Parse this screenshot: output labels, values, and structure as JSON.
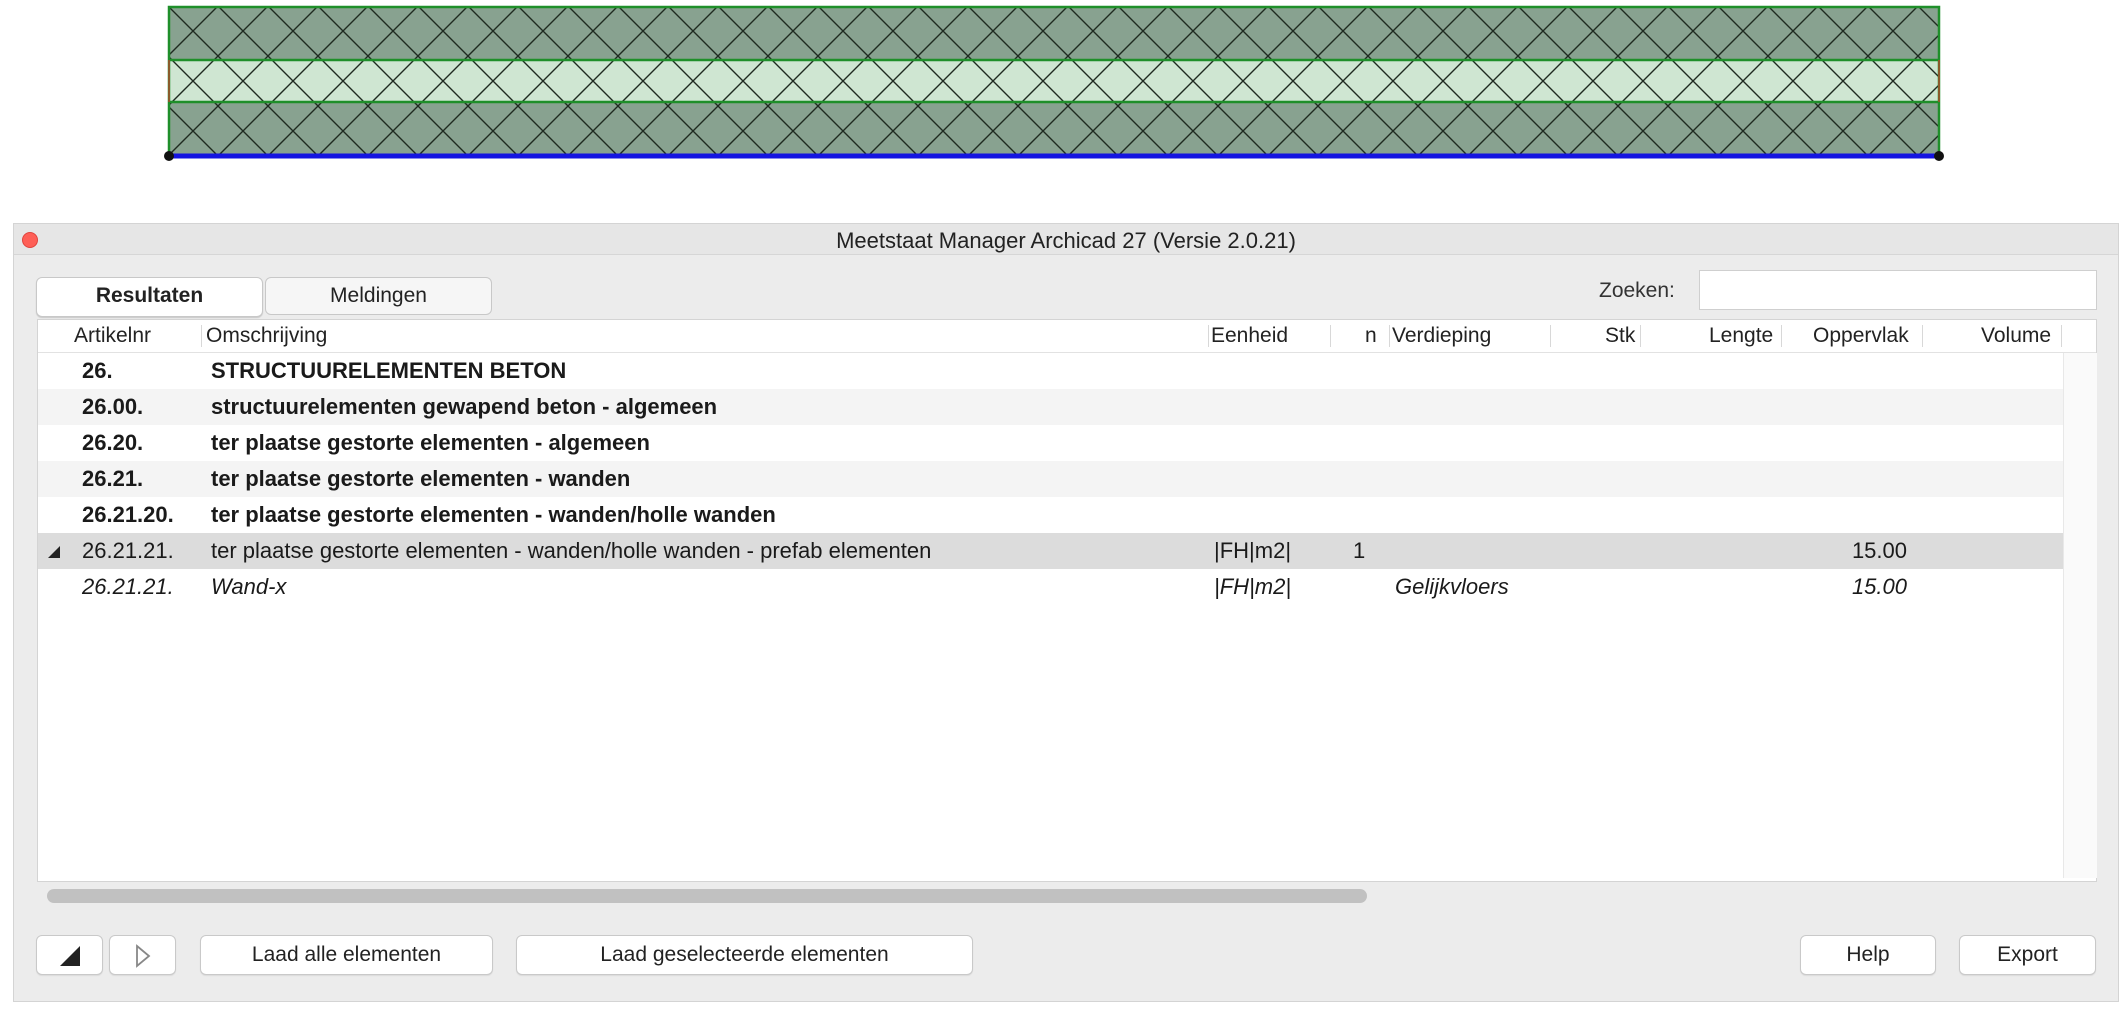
{
  "window": {
    "title": "Meetstaat Manager Archicad 27 (Versie 2.0.21)"
  },
  "tabs": [
    {
      "label": "Resultaten",
      "active": true
    },
    {
      "label": "Meldingen",
      "active": false
    }
  ],
  "search": {
    "label": "Zoeken:",
    "value": "",
    "placeholder": ""
  },
  "table": {
    "columns": [
      "Artikelnr",
      "Omschrijving",
      "Eenheid",
      "n",
      "Verdieping",
      "Stk",
      "Lengte",
      "Oppervlak",
      "Volume"
    ],
    "rows": [
      {
        "artikelnr": "26.",
        "omschrijving": "STRUCTUURELEMENTEN BETON",
        "eenheid": "",
        "n": "",
        "verdieping": "",
        "stk": "",
        "lengte": "",
        "oppervlak": "",
        "volume": "",
        "style": "bold"
      },
      {
        "artikelnr": "26.00.",
        "omschrijving": "structuurelementen gewapend beton - algemeen",
        "eenheid": "",
        "n": "",
        "verdieping": "",
        "stk": "",
        "lengte": "",
        "oppervlak": "",
        "volume": "",
        "style": "bold"
      },
      {
        "artikelnr": "26.20.",
        "omschrijving": "ter plaatse gestorte elementen - algemeen",
        "eenheid": "",
        "n": "",
        "verdieping": "",
        "stk": "",
        "lengte": "",
        "oppervlak": "",
        "volume": "",
        "style": "bold"
      },
      {
        "artikelnr": "26.21.",
        "omschrijving": "ter plaatse gestorte elementen - wanden",
        "eenheid": "",
        "n": "",
        "verdieping": "",
        "stk": "",
        "lengte": "",
        "oppervlak": "",
        "volume": "",
        "style": "bold"
      },
      {
        "artikelnr": "26.21.20.",
        "omschrijving": "ter plaatse gestorte elementen - wanden/holle wanden",
        "eenheid": "",
        "n": "",
        "verdieping": "",
        "stk": "",
        "lengte": "",
        "oppervlak": "",
        "volume": "",
        "style": "bold"
      },
      {
        "artikelnr": "26.21.21.",
        "omschrijving": "ter plaatse gestorte elementen - wanden/holle wanden - prefab elementen",
        "eenheid": "|FH|m2|",
        "n": "1",
        "verdieping": "",
        "stk": "",
        "lengte": "",
        "oppervlak": "15.00",
        "volume": "",
        "style": "selected",
        "expanded": true
      },
      {
        "artikelnr": "26.21.21.",
        "omschrijving": "Wand-x",
        "eenheid": "|FH|m2|",
        "n": "",
        "verdieping": "Gelijkvloers",
        "stk": "",
        "lengte": "",
        "oppervlak": "15.00",
        "volume": "",
        "style": "italic"
      }
    ]
  },
  "buttons": {
    "collapse_icon": "collapse-triangle-icon",
    "expand_icon": "expand-triangle-icon",
    "load_all": "Laad alle elementen",
    "load_selected": "Laad geselecteerde elementen",
    "help": "Help",
    "export": "Export"
  },
  "colors": {
    "wall_outer_fill": "#88a290",
    "wall_core_fill": "#cfe6d2",
    "wall_outline": "#1f8f2a",
    "reference_line": "#1414e0",
    "selected_row": "#dcdcdc",
    "close_button": "#fe5f57"
  }
}
